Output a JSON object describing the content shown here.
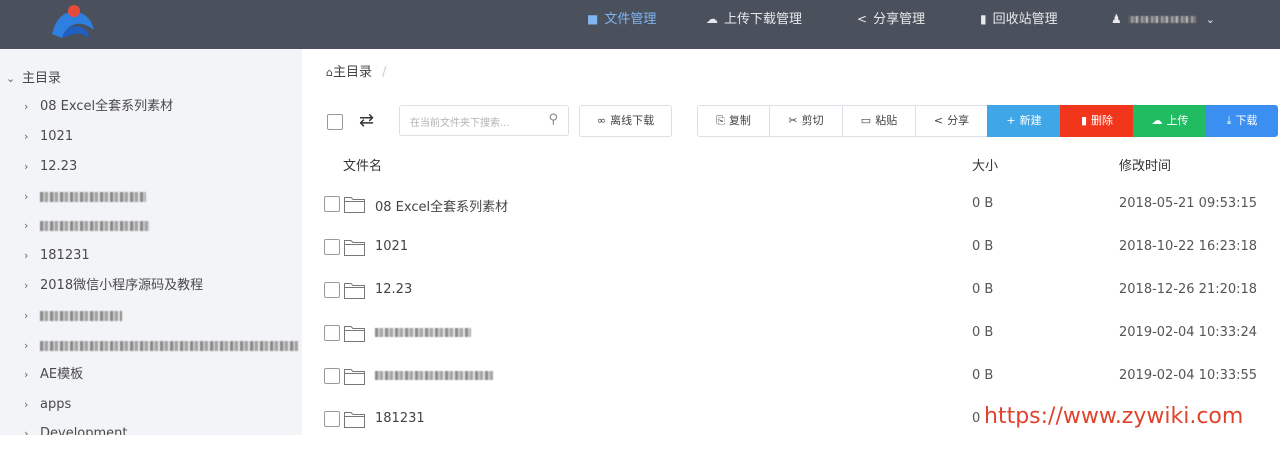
{
  "nav": {
    "items": [
      {
        "label": "文件管理",
        "icon": "folder-icon",
        "active": true
      },
      {
        "label": "上传下载管理",
        "icon": "cloud-icon",
        "active": false
      },
      {
        "label": "分享管理",
        "icon": "share-icon",
        "active": false
      },
      {
        "label": "回收站管理",
        "icon": "trash-icon",
        "active": false
      }
    ]
  },
  "sidebar": {
    "root_label": "主目录",
    "items": [
      {
        "label": "08 Excel全套系列素材"
      },
      {
        "label": "1021"
      },
      {
        "label": "12.23"
      },
      {
        "label": ""
      },
      {
        "label": ""
      },
      {
        "label": "181231"
      },
      {
        "label": "2018微信小程序源码及教程"
      },
      {
        "label": ""
      },
      {
        "label": ""
      },
      {
        "label": "AE模板"
      },
      {
        "label": "apps"
      },
      {
        "label": "Development"
      }
    ]
  },
  "breadcrumb": {
    "root": "主目录"
  },
  "toolbar": {
    "search_placeholder": "在当前文件夹下搜索...",
    "offline_download": "离线下载",
    "copy": "复制",
    "cut": "剪切",
    "paste": "粘贴",
    "share": "分享",
    "new": "新建",
    "delete": "删除",
    "upload": "上传",
    "download": "下载"
  },
  "table": {
    "headers": {
      "name": "文件名",
      "size": "大小",
      "modified": "修改时间"
    },
    "rows": [
      {
        "name": "08 Excel全套系列素材",
        "size": "0 B",
        "modified": "2018-05-21 09:53:15"
      },
      {
        "name": "1021",
        "size": "0 B",
        "modified": "2018-10-22 16:23:18"
      },
      {
        "name": "12.23",
        "size": "0 B",
        "modified": "2018-12-26 21:20:18"
      },
      {
        "name": "",
        "size": "0 B",
        "modified": "2019-02-04 10:33:24"
      },
      {
        "name": "",
        "size": "0 B",
        "modified": "2019-02-04 10:33:55"
      },
      {
        "name": "181231",
        "size": "0",
        "modified": ""
      }
    ]
  },
  "watermark": "https://www.zywiki.com",
  "colors": {
    "topbar": "#4b505d",
    "accent": "#7fb5f0",
    "new": "#3fa7e8",
    "delete": "#f2361c",
    "upload": "#21bc62",
    "download": "#3a8ff0"
  }
}
